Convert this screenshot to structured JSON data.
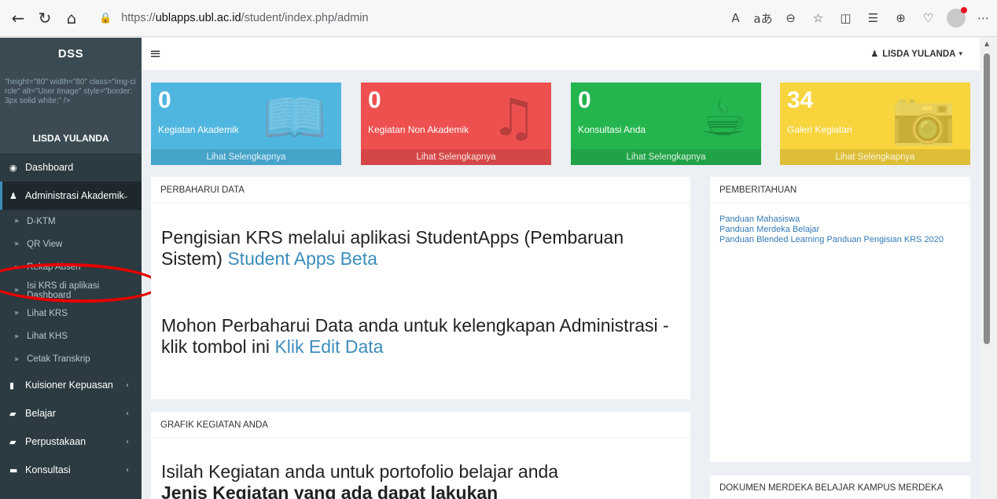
{
  "browser": {
    "back_icon": "←",
    "reload_icon": "↻",
    "home_icon": "⌂",
    "lock_icon": "🔒",
    "url_prefix": "https://",
    "url_domain": "ublapps.ubl.ac.id",
    "url_path": "/student/index.php/admin",
    "read_aloud_icon": "A",
    "immersive_icon": "aあ",
    "zoom_icon": "⊖",
    "favorite_icon": "☆",
    "split_icon": "◫",
    "favorites_list_icon": "☰",
    "collections_icon": "⊕",
    "health_icon": "♡",
    "more_icon": "⋯"
  },
  "sidebar": {
    "logo": "DSS",
    "broken_image_text": "\"height=\"80\" width=\"80\" class=\"img-circle\" alt=\"User Image\" style=\"border: 3px solid white;\" />",
    "user_name": "LISDA YULANDA",
    "items": [
      {
        "label": "Dashboard",
        "icon": "◉",
        "arrow": ""
      },
      {
        "label": "Administrasi Akademik",
        "icon": "♟",
        "arrow": "⌄"
      }
    ],
    "submenu": [
      {
        "label": "D-KTM"
      },
      {
        "label": "QR View"
      },
      {
        "label": "Rekap Absen"
      },
      {
        "label": "Isi KRS di aplikasi Dashboard"
      },
      {
        "label": "Lihat KRS"
      },
      {
        "label": "Lihat KHS"
      },
      {
        "label": "Cetak Transkrip"
      }
    ],
    "items_bottom": [
      {
        "label": "Kuisioner Kepuasan",
        "icon": "▮",
        "arrow": "‹"
      },
      {
        "label": "Belajar",
        "icon": "▰",
        "arrow": "‹"
      },
      {
        "label": "Perpustakaan",
        "icon": "▰",
        "arrow": "‹"
      },
      {
        "label": "Konsultasi",
        "icon": "▬",
        "arrow": "‹"
      }
    ],
    "submenu_chevron": "»"
  },
  "header": {
    "hamburger": "≡",
    "user_label": "LISDA YULANDA",
    "user_icon": "♟",
    "caret": "▾"
  },
  "stats": [
    {
      "value": "0",
      "label": "Kegiatan Akademik",
      "footer": "Lihat Selengkapnya",
      "color": "#4fb6e0",
      "icon": "📖"
    },
    {
      "value": "0",
      "label": "Kegiatan Non Akademik",
      "footer": "Lihat Selengkapnya",
      "color": "#ee5050",
      "icon": "♫"
    },
    {
      "value": "0",
      "label": "Konsultasi Anda",
      "footer": "Lihat Selengkapnya",
      "color": "#24b54e",
      "icon": "☕"
    },
    {
      "value": "34",
      "label": "Galeri Kegiatan",
      "footer": "Lihat Selengkapnya",
      "color": "#f8d43d",
      "icon": "📷"
    }
  ],
  "panels": {
    "update": {
      "title": "PERBAHARUI DATA",
      "text1": "Pengisian KRS melalui aplikasi StudentApps (Pembaruan Sistem) ",
      "link1": "Student Apps Beta",
      "text2": "Mohon Perbaharui Data anda untuk kelengkapan Administrasi - klik tombol ini ",
      "link2": "Klik Edit Data"
    },
    "graph": {
      "title": "GRAFIK KEGIATAN ANDA",
      "text1": "Isilah Kegiatan anda untuk portofolio belajar anda",
      "text2": "Jenis Kegiatan yang ada dapat lakukan"
    },
    "notice": {
      "title": "PEMBERITAHUAN",
      "links": [
        "Panduan Mahasiswa",
        "Panduan Merdeka Belajar",
        "Panduan Blended Learning Panduan Pengisian KRS 2020"
      ]
    },
    "docs": {
      "title": "DOKUMEN MERDEKA BELAJAR KAMPUS MERDEKA"
    }
  }
}
